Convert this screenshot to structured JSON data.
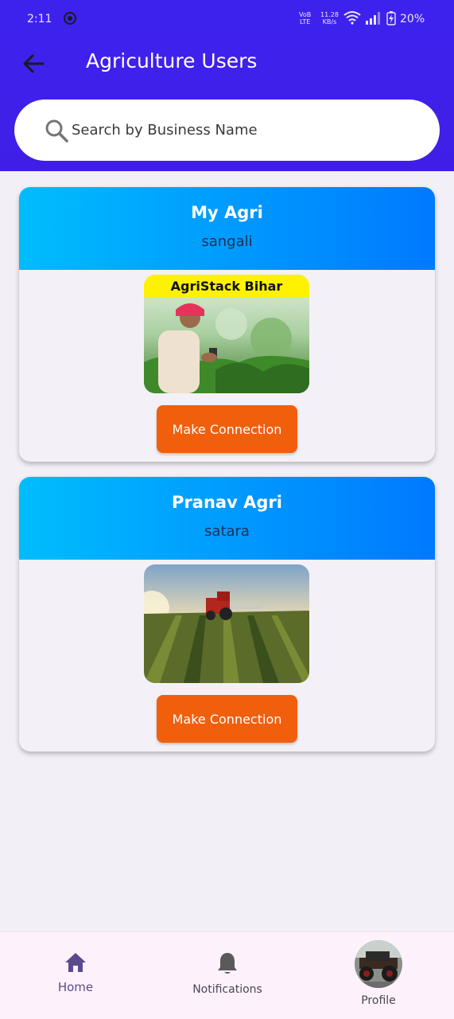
{
  "status_bar": {
    "time": "2:11",
    "volte": "VoB",
    "lte": "LTE",
    "speed_value": "11.28",
    "speed_unit": "KB/s",
    "battery": "20%"
  },
  "header": {
    "title": "Agriculture Users"
  },
  "search": {
    "placeholder": "Search by Business Name"
  },
  "cards": [
    {
      "name": "My Agri",
      "location": "sangali",
      "image_banner": "AgriStack Bihar",
      "button_label": "Make Connection"
    },
    {
      "name": "Pranav Agri",
      "location": "satara",
      "button_label": "Make Connection"
    }
  ],
  "bottom_nav": {
    "items": [
      {
        "label": "Home",
        "icon": "home-icon",
        "active": true
      },
      {
        "label": "Notifications",
        "icon": "bell-icon"
      },
      {
        "label": "Profile",
        "icon": "avatar"
      }
    ]
  },
  "colors": {
    "header": "#3d22ee",
    "card_gradient_start": "#00bdfd",
    "card_gradient_end": "#0079ff",
    "button": "#f25f0c",
    "nav_active": "#5b4a8e"
  }
}
